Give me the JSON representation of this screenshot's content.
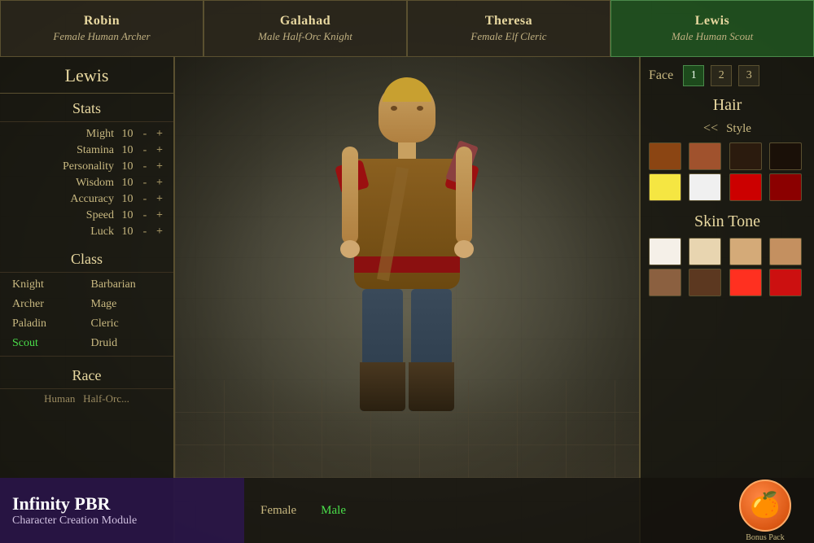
{
  "tabs": [
    {
      "id": "robin",
      "name": "Robin",
      "desc": "Female Human Archer",
      "active": false
    },
    {
      "id": "galahad",
      "name": "Galahad",
      "desc": "Male Half-Orc Knight",
      "active": false
    },
    {
      "id": "theresa",
      "name": "Theresa",
      "desc": "Female Elf Cleric",
      "active": false
    },
    {
      "id": "lewis",
      "name": "Lewis",
      "desc": "Male Human Scout",
      "active": true
    }
  ],
  "character": {
    "name": "Lewis",
    "stats_title": "Stats",
    "stats": [
      {
        "label": "Might",
        "value": "10"
      },
      {
        "label": "Stamina",
        "value": "10"
      },
      {
        "label": "Personality",
        "value": "10"
      },
      {
        "label": "Wisdom",
        "value": "10"
      },
      {
        "label": "Accuracy",
        "value": "10"
      },
      {
        "label": "Speed",
        "value": "10"
      },
      {
        "label": "Luck",
        "value": "10"
      }
    ],
    "class_title": "Class",
    "classes_col1": [
      "Knight",
      "Archer",
      "Paladin",
      "Scout"
    ],
    "classes_col2": [
      "Barbarian",
      "Mage",
      "Cleric",
      "Druid"
    ],
    "active_class": "Scout",
    "race_title": "Race"
  },
  "right_panel": {
    "face_label": "Face",
    "face_options": [
      "1",
      "2",
      "3"
    ],
    "face_active": "1",
    "hair_title": "Hair",
    "style_arrow": "<<",
    "style_label": "Style",
    "hair_colors": [
      "#8B4513",
      "#A0522D",
      "#2B1B0E",
      "#1a1008",
      "#F5E642",
      "#F0F0F0",
      "#CC0000",
      "#8B0000"
    ],
    "skin_title": "Skin Tone",
    "skin_colors": [
      "#F5F0E8",
      "#E8D5B0",
      "#D4AA78",
      "#C49060",
      "#8B6040",
      "#5C3820",
      "#FF3020",
      "#CC1010"
    ]
  },
  "bottom": {
    "brand_title": "Infinity PBR",
    "brand_sub": "Character Creation Module",
    "gender_options": [
      "Female",
      "Male"
    ],
    "active_gender": "Male",
    "bonus_label": "Bonus Pack"
  }
}
